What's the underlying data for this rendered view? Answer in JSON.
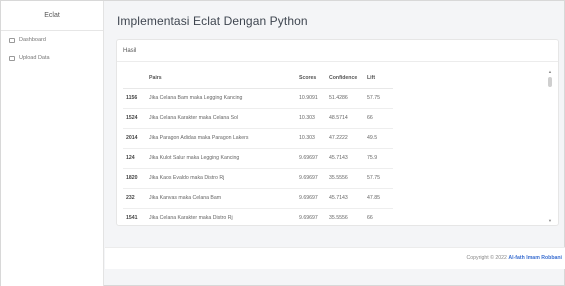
{
  "sidebar": {
    "brand": "Eclat",
    "items": [
      {
        "label": "Dashboard"
      },
      {
        "label": "Upload Data"
      }
    ]
  },
  "main": {
    "title": "Implementasi Eclat Dengan Python",
    "card_title": "Hasil"
  },
  "table": {
    "headers": {
      "id": "",
      "pairs": "Pairs",
      "scores": "Scores",
      "confidence": "Confidence",
      "lift": "Lift"
    },
    "rows": [
      {
        "id": "1156",
        "pairs": "Jika Celana Bam maka Legging Kancing",
        "scores": "10.9091",
        "confidence": "51.4286",
        "lift": "57.75"
      },
      {
        "id": "1524",
        "pairs": "Jika Celana Karakter maka Celana Sol",
        "scores": "10.303",
        "confidence": "48.5714",
        "lift": "66"
      },
      {
        "id": "2014",
        "pairs": "Jika Paragon Adidas maka Paragon Lakers",
        "scores": "10.303",
        "confidence": "47.2222",
        "lift": "49.5"
      },
      {
        "id": "124",
        "pairs": "Jika Kulot Salur maka Legging Kancing",
        "scores": "9.69697",
        "confidence": "45.7143",
        "lift": "75.9"
      },
      {
        "id": "1820",
        "pairs": "Jika Kaos Evaldo maka Distro Rj",
        "scores": "9.69697",
        "confidence": "35.5556",
        "lift": "57.75"
      },
      {
        "id": "232",
        "pairs": "Jika Kanvas maka Celana Bam",
        "scores": "9.69697",
        "confidence": "45.7143",
        "lift": "47.85"
      },
      {
        "id": "1541",
        "pairs": "Jika Celana Karakter maka Distro Rj",
        "scores": "9.69697",
        "confidence": "35.5556",
        "lift": "66"
      }
    ]
  },
  "footer": {
    "prefix": "Copyright © 2022 ",
    "author": "Al-fath Imam Robbani"
  },
  "icons": {
    "dashboard": "dashboard-icon",
    "upload": "upload-icon"
  },
  "colors": {
    "accent": "#3b6fd1"
  }
}
